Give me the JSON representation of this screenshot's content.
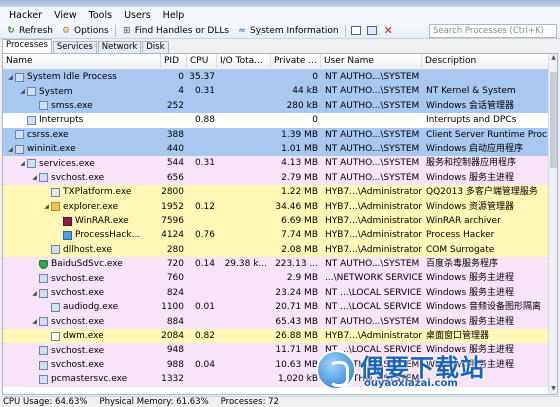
{
  "menu": [
    "Hacker",
    "View",
    "Tools",
    "Users",
    "Help"
  ],
  "toolbar": {
    "refresh": "Refresh",
    "options": "Options",
    "find": "Find Handles or DLLs",
    "sysinfo": "System Information",
    "search_placeholder": "Search Processes (Ctrl+K)"
  },
  "tabs": [
    "Processes",
    "Services",
    "Network",
    "Disk"
  ],
  "columns": [
    "Name",
    "PID",
    "CPU",
    "I/O Tota...",
    "Private ...",
    "User Name",
    "Description"
  ],
  "rows": [
    {
      "name": "System Idle Process",
      "pid": "0",
      "cpu": "35.37",
      "io": "",
      "priv": "0",
      "user": "NT AUTHO...\\SYSTEM",
      "desc": "",
      "icon": "app",
      "tree": "expanded"
    },
    {
      "name": "System",
      "pid": "4",
      "cpu": "0.31",
      "io": "",
      "priv": "44 kB",
      "user": "NT AUTHO...\\SYSTEM",
      "desc": "NT Kernel & System",
      "icon": "app",
      "tree": "expanded"
    },
    {
      "name": "smss.exe",
      "pid": "252",
      "cpu": "",
      "io": "",
      "priv": "280 kB",
      "user": "NT AUTHO...\\SYSTEM",
      "desc": "Windows 会话管理器",
      "icon": "app",
      "tree": "none"
    },
    {
      "name": "Interrupts",
      "pid": "",
      "cpu": "0.88",
      "io": "",
      "priv": "0",
      "user": "",
      "desc": "Interrupts and DPCs",
      "icon": "app",
      "tree": "none"
    },
    {
      "name": "csrss.exe",
      "pid": "388",
      "cpu": "",
      "io": "",
      "priv": "1.39 MB",
      "user": "NT AUTHO...\\SYSTEM",
      "desc": "Client Server Runtime Proc...",
      "icon": "app",
      "tree": "none"
    },
    {
      "name": "wininit.exe",
      "pid": "440",
      "cpu": "",
      "io": "",
      "priv": "1.01 MB",
      "user": "NT AUTHO...\\SYSTEM",
      "desc": "Windows 启动应用程序",
      "icon": "app",
      "tree": "expanded"
    },
    {
      "name": "services.exe",
      "pid": "544",
      "cpu": "0.31",
      "io": "",
      "priv": "4.13 MB",
      "user": "NT AUTHO...\\SYSTEM",
      "desc": "服务和控制器应用程序",
      "icon": "app",
      "tree": "expanded"
    },
    {
      "name": "svchost.exe",
      "pid": "656",
      "cpu": "",
      "io": "",
      "priv": "2.79 MB",
      "user": "NT AUTHO...\\SYSTEM",
      "desc": "Windows 服务主进程",
      "icon": "app",
      "tree": "expanded"
    },
    {
      "name": "TXPlatform.exe",
      "pid": "2800",
      "cpu": "",
      "io": "",
      "priv": "1.22 MB",
      "user": "HYB7...\\Administrator",
      "desc": "QQ2013 多客户端管理服务",
      "icon": "txp",
      "tree": "none"
    },
    {
      "name": "explorer.exe",
      "pid": "1952",
      "cpu": "0.12",
      "io": "",
      "priv": "34.46 MB",
      "user": "HYB7...\\Administrator",
      "desc": "Windows 资源管理器",
      "icon": "folder",
      "tree": "expanded"
    },
    {
      "name": "WinRAR.exe",
      "pid": "7596",
      "cpu": "",
      "io": "",
      "priv": "6.69 MB",
      "user": "HYB7...\\Administrator",
      "desc": "WinRAR archiver",
      "icon": "rar",
      "tree": "none"
    },
    {
      "name": "ProcessHack...",
      "pid": "4124",
      "cpu": "0.76",
      "io": "",
      "priv": "7.74 MB",
      "user": "HYB7...\\Administrator",
      "desc": "Process Hacker",
      "icon": "ph",
      "tree": "none"
    },
    {
      "name": "dllhost.exe",
      "pid": "280",
      "cpu": "",
      "io": "",
      "priv": "2.08 MB",
      "user": "HYB7...\\Administrator",
      "desc": "COM Surrogate",
      "icon": "app",
      "tree": "none"
    },
    {
      "name": "BaiduSdSvc.exe",
      "pid": "720",
      "cpu": "0.14",
      "io": "29.38 k...",
      "priv": "223.13 ...",
      "user": "NT AUTHO...\\SYSTEM",
      "desc": "百度杀毒服务程序",
      "icon": "shield",
      "tree": "none"
    },
    {
      "name": "svchost.exe",
      "pid": "760",
      "cpu": "",
      "io": "",
      "priv": "2.9 MB",
      "user": "...\\NETWORK SERVICE",
      "desc": "Windows 服务主进程",
      "icon": "app",
      "tree": "none"
    },
    {
      "name": "svchost.exe",
      "pid": "824",
      "cpu": "",
      "io": "",
      "priv": "23.24 MB",
      "user": "NT ...\\LOCAL SERVICE",
      "desc": "Windows 服务主进程",
      "icon": "app",
      "tree": "expanded"
    },
    {
      "name": "audiodg.exe",
      "pid": "1100",
      "cpu": "0.01",
      "io": "",
      "priv": "20.71 MB",
      "user": "NT ...\\LOCAL SERVICE",
      "desc": "Windows 音频设备图形隔离",
      "icon": "app",
      "tree": "none"
    },
    {
      "name": "svchost.exe",
      "pid": "884",
      "cpu": "",
      "io": "",
      "priv": "65.43 MB",
      "user": "NT AUTHO...\\SYSTEM",
      "desc": "Windows 服务主进程",
      "icon": "app",
      "tree": "expanded"
    },
    {
      "name": "dwm.exe",
      "pid": "2084",
      "cpu": "0.82",
      "io": "",
      "priv": "26.88 MB",
      "user": "HYB7...\\Administrator",
      "desc": "桌面窗口管理器",
      "icon": "dwm",
      "tree": "none"
    },
    {
      "name": "svchost.exe",
      "pid": "948",
      "cpu": "",
      "io": "",
      "priv": "11.71 MB",
      "user": "NT ...\\LOCAL SERVICE",
      "desc": "Windows 服务主进程",
      "icon": "app",
      "tree": "none"
    },
    {
      "name": "svchost.exe",
      "pid": "988",
      "cpu": "0.04",
      "io": "",
      "priv": "10.63 MB",
      "user": "NT AUTHO...\\SYSTEM",
      "desc": "Windows 服务主进程",
      "icon": "app",
      "tree": "none"
    },
    {
      "name": "pcmastersvc.exe",
      "pid": "1332",
      "cpu": "",
      "io": "",
      "priv": "1,020 kB",
      "user": "NT AUTHO...\\SYSTEM",
      "desc": "",
      "icon": "app",
      "tree": "none"
    }
  ],
  "status": {
    "cpu": "CPU Usage: 64.63%",
    "mem": "Physical Memory: 61.63%",
    "procs": "Processes: 72"
  },
  "watermark": {
    "title": "偶要下载站",
    "url": "ouyaoxiazai.com"
  },
  "colors": {
    "system_process": "#a8c8f0",
    "service_process": "#f8e4f8",
    "own_process": "#fff7b6"
  }
}
